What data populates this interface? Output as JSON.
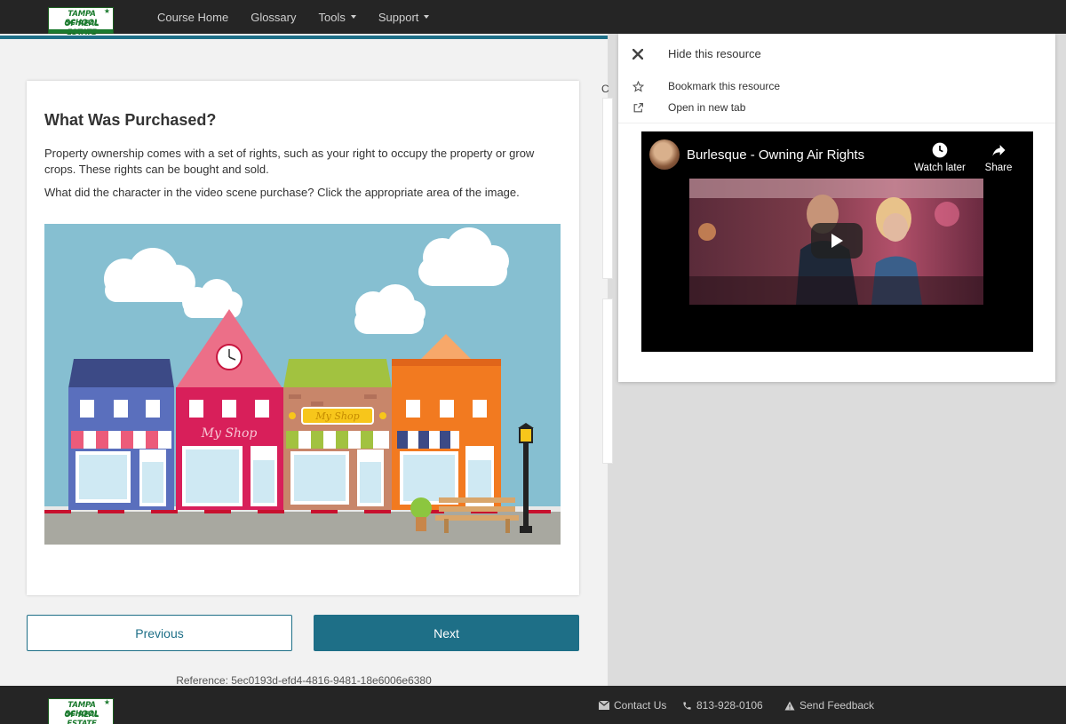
{
  "brand": {
    "logo_line1": "TAMPA SCHOOL",
    "logo_line2": "OF REAL ESTATE"
  },
  "nav": {
    "items": [
      {
        "label": "Course Home"
      },
      {
        "label": "Glossary"
      },
      {
        "label": "Tools"
      },
      {
        "label": "Support"
      }
    ]
  },
  "question": {
    "title": "What Was Purchased?",
    "paragraph1": "Property ownership comes with a set of rights, such as your right to occupy the property or grow crops. These rights can be bought and sold.",
    "paragraph2": "What did the character in the video scene purchase? Click the appropriate area of the image.",
    "shop_sign": "My Shop"
  },
  "navigation": {
    "previous_label": "Previous",
    "next_label": "Next"
  },
  "reference": "Reference: 5ec0193d-efd4-4816-9481-18e6006e6380",
  "peek": {
    "letter": "C"
  },
  "resource_panel": {
    "hide_label": "Hide this resource",
    "bookmark_label": "Bookmark this resource",
    "open_label": "Open in new tab"
  },
  "video": {
    "title": "Burlesque - Owning Air Rights",
    "watch_later_label": "Watch later",
    "share_label": "Share"
  },
  "footer": {
    "contact_label": "Contact Us",
    "phone": "813-928-0106",
    "feedback_label": "Send Feedback"
  },
  "colors": {
    "accent": "#1e6f87",
    "nav_bg": "#252525",
    "sky": "#86bfd1"
  }
}
